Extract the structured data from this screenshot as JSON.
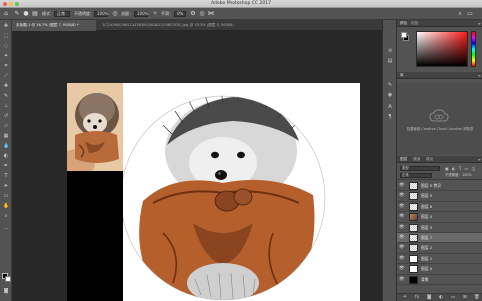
{
  "window": {
    "title": "Adobe Photoshop CC 2017"
  },
  "options_bar": {
    "mode_label": "模式：",
    "mode_value": "正常",
    "opacity_label": "不透明度：",
    "opacity_value": "100%",
    "flow_label": "流量：",
    "flow_value": "100%",
    "smoothing_label": "平滑：",
    "smoothing_value": "0%"
  },
  "tabs": [
    {
      "label": "未标题-1 @ 16.7% (图层 7, RGB/8) *",
      "active": true
    },
    {
      "label": "1C23098A7661C41E6B92DB3A1C05BF2E3C.jpg @ 33.3% (图层 0, RGB/8)",
      "active": false
    }
  ],
  "panels": {
    "color": {
      "tab_color": "颜色",
      "tab_swatches": "色板"
    },
    "cc_libraries": {
      "tab": "库",
      "message": "若要使用 Creative Cloud Libraries 请登录"
    },
    "layers": {
      "tab_layers": "图层",
      "tab_channels": "通道",
      "tab_paths": "路径",
      "filter_label": "类型",
      "blend_mode": "正常",
      "opacity_label": "不透明度：100%",
      "fill_label": "填充：100%",
      "items": [
        {
          "name": "图层 5 拷贝",
          "thumb": "check",
          "selected": false
        },
        {
          "name": "图层 5",
          "thumb": "check",
          "selected": false
        },
        {
          "name": "图层 6",
          "thumb": "check",
          "selected": false
        },
        {
          "name": "图层 4",
          "thumb": "photo",
          "selected": false
        },
        {
          "name": "图层 3",
          "thumb": "check",
          "selected": false
        },
        {
          "name": "图层 7",
          "thumb": "check",
          "selected": true
        },
        {
          "name": "图层 2",
          "thumb": "check",
          "selected": false
        },
        {
          "name": "图层 1",
          "thumb": "white",
          "selected": false
        },
        {
          "name": "图层 0",
          "thumb": "white",
          "selected": false
        },
        {
          "name": "背景",
          "thumb": "black",
          "selected": false
        }
      ]
    }
  },
  "colors": {
    "ui_dark": "#535353",
    "canvas_bg": "#282828",
    "scarf": "#b5602c",
    "scarf_dark": "#6e2f12"
  }
}
